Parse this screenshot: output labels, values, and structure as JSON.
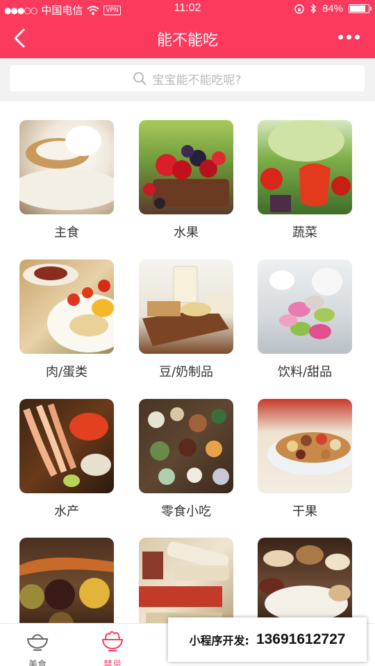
{
  "status_bar": {
    "carrier": "中国电信",
    "vpn": "VPN",
    "time": "11:02",
    "battery": "84%",
    "battery_level": 0.84
  },
  "nav": {
    "title": "能不能吃",
    "back_icon": "back-arrow-icon",
    "more_icon": "more-dots-icon"
  },
  "search": {
    "placeholder": "宝宝能不能吃呢?"
  },
  "categories": [
    {
      "label": "主食",
      "icon": "rice-photo"
    },
    {
      "label": "水果",
      "icon": "fruit-photo"
    },
    {
      "label": "蔬菜",
      "icon": "vegetable-photo"
    },
    {
      "label": "肉/蛋类",
      "icon": "meat-egg-photo"
    },
    {
      "label": "豆/奶制品",
      "icon": "bean-dairy-photo"
    },
    {
      "label": "饮料/甜品",
      "icon": "drink-dessert-photo"
    },
    {
      "label": "水产",
      "icon": "seafood-photo"
    },
    {
      "label": "零食小吃",
      "icon": "snacks-photo"
    },
    {
      "label": "干果",
      "icon": "nuts-photo"
    },
    {
      "label": "",
      "icon": "spices-photo"
    },
    {
      "label": "",
      "icon": "herbs-photo"
    },
    {
      "label": "",
      "icon": "mushroom-photo"
    }
  ],
  "tabbar": {
    "items": [
      {
        "label": "美食",
        "icon": "bowl-icon",
        "state": "normal"
      },
      {
        "label": "禁忌",
        "icon": "salad-icon",
        "state": "active"
      },
      {
        "label": "",
        "icon": "hidden-tab-icon",
        "state": "covered"
      },
      {
        "label": "",
        "icon": "hidden-tab-icon",
        "state": "covered"
      },
      {
        "label": "",
        "icon": "hidden-tab-icon",
        "state": "covered"
      }
    ]
  },
  "ad": {
    "label": "小程序开发:",
    "phone": "13691612727"
  },
  "colors": {
    "brand": "#fb3a5e",
    "background": "#f2f2f2"
  }
}
